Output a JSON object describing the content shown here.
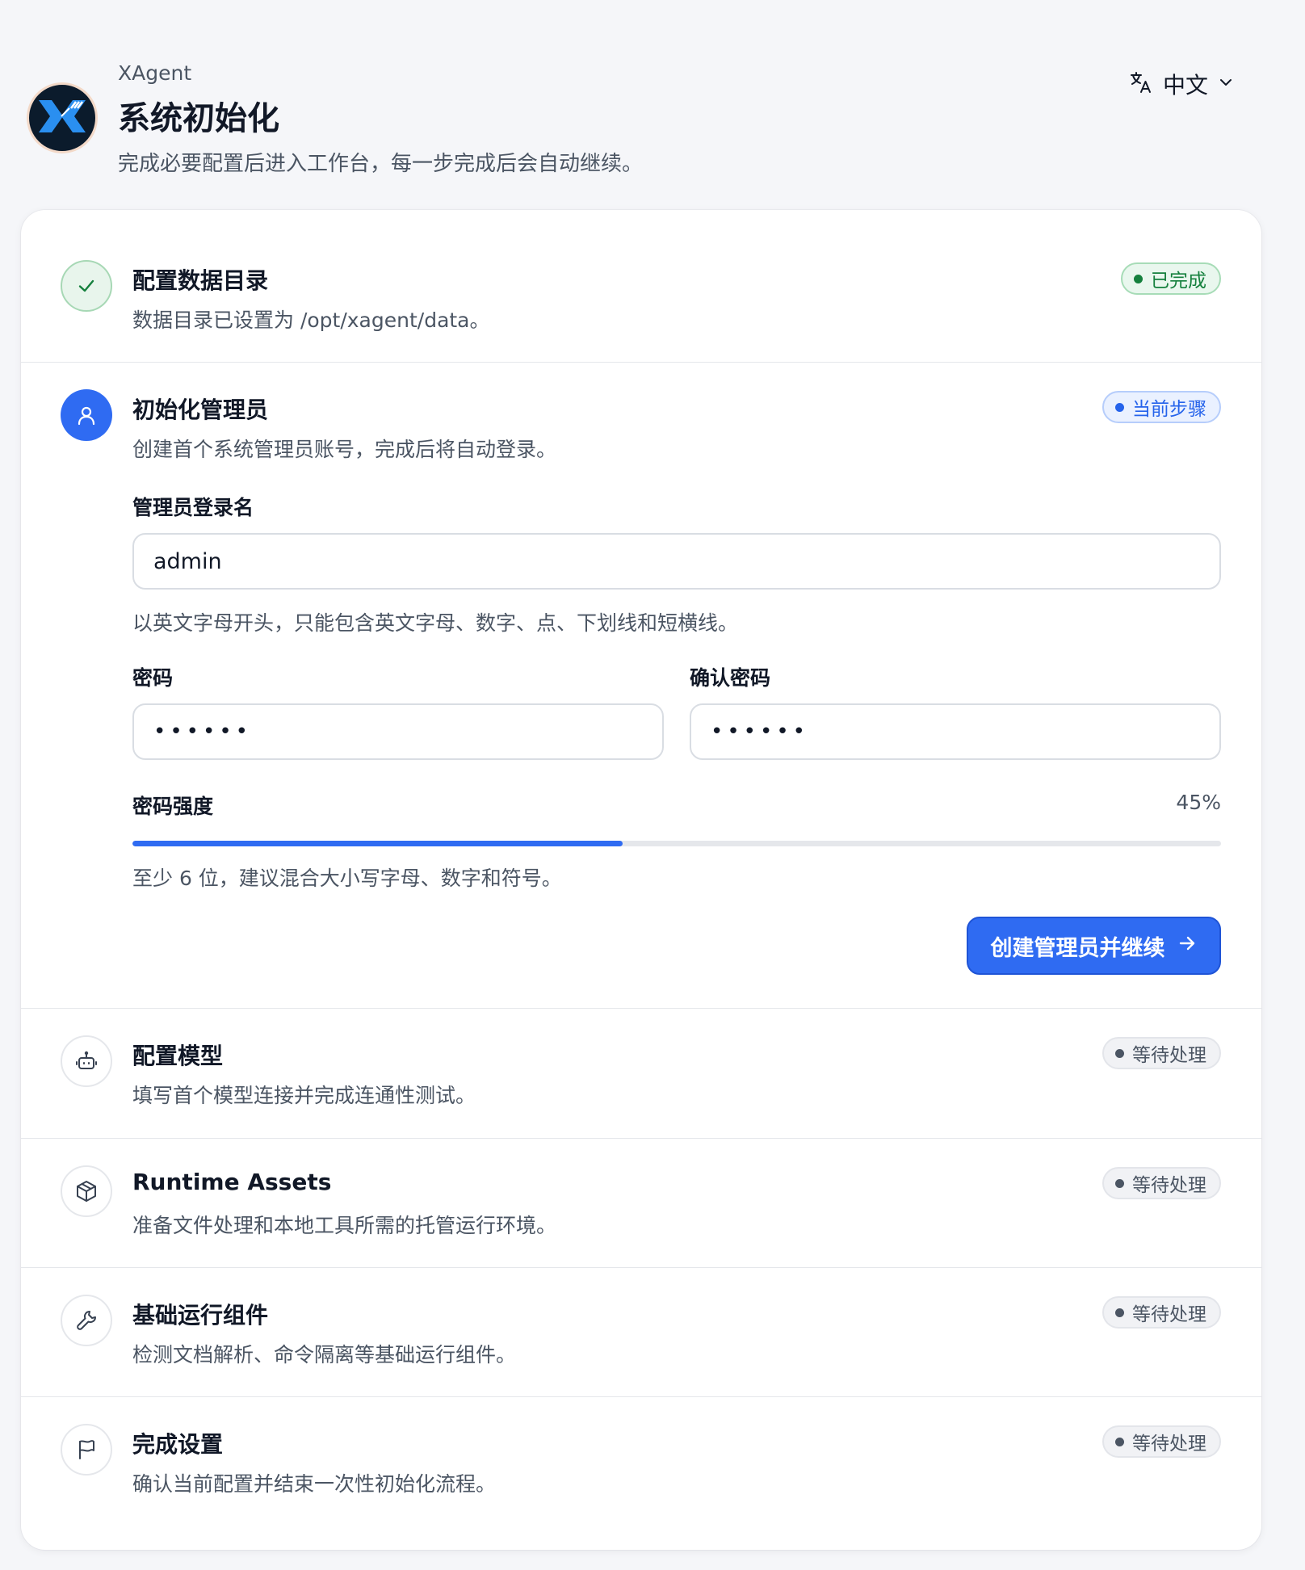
{
  "header": {
    "app_name": "XAgent",
    "title": "系统初始化",
    "subtitle": "完成必要配置后进入工作台，每一步完成后会自动继续。",
    "language": "中文"
  },
  "steps": [
    {
      "title": "配置数据目录",
      "desc": "数据目录已设置为 /opt/xagent/data。",
      "status": "已完成",
      "icon": "check-icon"
    },
    {
      "title": "初始化管理员",
      "desc": "创建首个系统管理员账号，完成后将自动登录。",
      "status": "当前步骤",
      "icon": "user-icon"
    },
    {
      "title": "配置模型",
      "desc": "填写首个模型连接并完成连通性测试。",
      "status": "等待处理",
      "icon": "robot-icon"
    },
    {
      "title": "Runtime Assets",
      "desc": "准备文件处理和本地工具所需的托管运行环境。",
      "status": "等待处理",
      "icon": "package-icon"
    },
    {
      "title": "基础运行组件",
      "desc": "检测文档解析、命令隔离等基础运行组件。",
      "status": "等待处理",
      "icon": "wrench-icon"
    },
    {
      "title": "完成设置",
      "desc": "确认当前配置并结束一次性初始化流程。",
      "status": "等待处理",
      "icon": "flag-icon"
    }
  ],
  "admin_form": {
    "username_label": "管理员登录名",
    "username_value": "admin",
    "username_hint": "以英文字母开头，只能包含英文字母、数字、点、下划线和短横线。",
    "password_label": "密码",
    "password_value": "••••••",
    "confirm_label": "确认密码",
    "confirm_value": "••••••",
    "strength_label": "密码强度",
    "strength_text": "45%",
    "strength_fraction": 0.45,
    "strength_hint": "至少 6 位，建议混合大小写字母、数字和符号。",
    "submit_label": "创建管理员并继续"
  },
  "colors": {
    "accent": "#2f6bf2",
    "success": "#15803d",
    "muted": "#4b5563"
  }
}
